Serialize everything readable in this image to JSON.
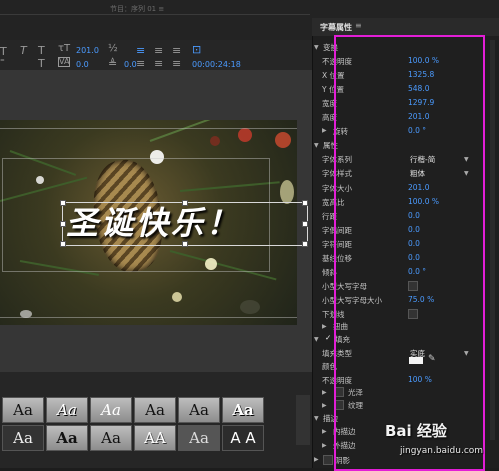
{
  "top": {
    "tab": "节目：序列 01 ≡"
  },
  "toolbar": {
    "font_size": "201.0",
    "tracking": "0.0",
    "leading": "0.0",
    "timecode": "00:00:24:18"
  },
  "stage": {
    "title_text": "圣诞快乐！"
  },
  "styles": {
    "row1": [
      "Aa",
      "Aa",
      "Aa",
      "Aa",
      "Aa",
      "Aa"
    ],
    "row2": [
      "Aa",
      "Aa",
      "Aa",
      "AA",
      "Aa",
      "A A"
    ]
  },
  "panel": {
    "title": "字幕属性",
    "menu": "≡",
    "transform": {
      "label": "变换",
      "rows": [
        {
          "label": "不透明度",
          "value": "100.0 %"
        },
        {
          "label": "X 位置",
          "value": "1325.8"
        },
        {
          "label": "Y 位置",
          "value": "548.0"
        },
        {
          "label": "宽度",
          "value": "1297.9"
        },
        {
          "label": "高度",
          "value": "201.0"
        },
        {
          "label": "旋转",
          "value": "0.0 °"
        }
      ]
    },
    "properties": {
      "label": "属性",
      "rows": [
        {
          "label": "字体系列",
          "value": "行楷-简"
        },
        {
          "label": "字体样式",
          "value": "粗体"
        },
        {
          "label": "字体大小",
          "value": "201.0"
        },
        {
          "label": "宽高比",
          "value": "100.0 %"
        },
        {
          "label": "行距",
          "value": "0.0"
        },
        {
          "label": "字偶间距",
          "value": "0.0"
        },
        {
          "label": "字符间距",
          "value": "0.0"
        },
        {
          "label": "基线位移",
          "value": "0.0"
        },
        {
          "label": "倾斜",
          "value": "0.0 °"
        },
        {
          "label": "小型大写字母",
          "value": ""
        },
        {
          "label": "小型大写字母大小",
          "value": "75.0 %"
        },
        {
          "label": "下划线",
          "value": ""
        },
        {
          "label": "扭曲",
          "value": ""
        }
      ]
    },
    "fill": {
      "label": "填充",
      "rows": [
        {
          "label": "填充类型",
          "value": "实底"
        },
        {
          "label": "颜色",
          "value": ""
        },
        {
          "label": "不透明度",
          "value": "100 %"
        },
        {
          "label": "光泽",
          "value": ""
        },
        {
          "label": "纹理",
          "value": ""
        }
      ]
    },
    "stroke": {
      "label": "描边",
      "rows": [
        {
          "label": "内描边",
          "value": ""
        },
        {
          "label": "外描边",
          "value": ""
        }
      ]
    },
    "shadow": {
      "label": "阴影"
    }
  },
  "watermark": {
    "brand": "Bai 经验",
    "url": "jingyan.baidu.com"
  },
  "colors": {
    "accent": "#4b9bff",
    "highlight_box": "#e21ed6"
  }
}
